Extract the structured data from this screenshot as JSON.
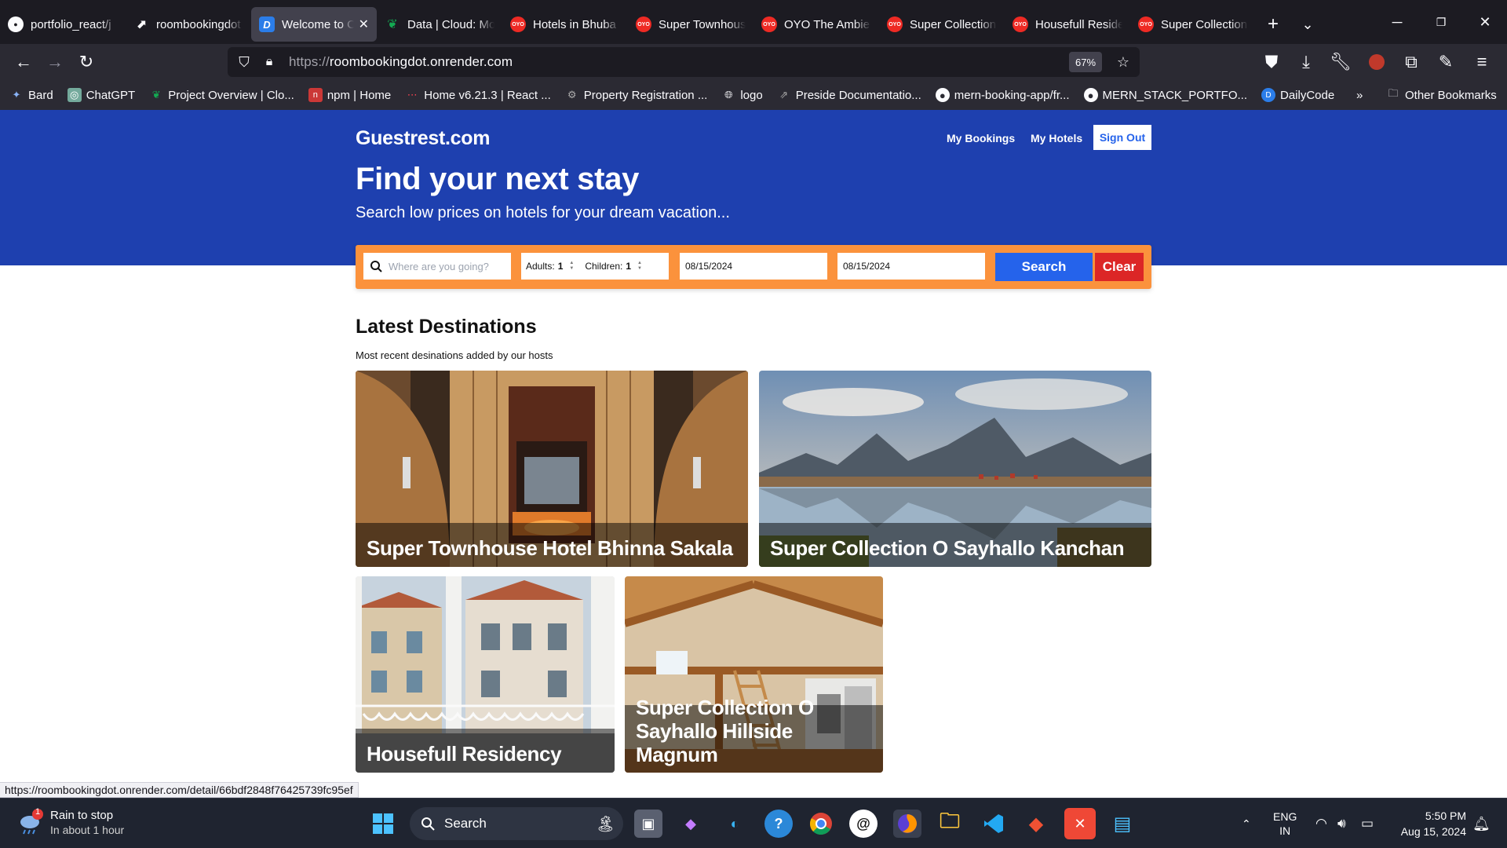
{
  "browser": {
    "tabs": [
      {
        "title": "portfolio_react/j",
        "favicon": "github-icon",
        "active": false
      },
      {
        "title": "roombookingdot",
        "favicon": "render-icon",
        "active": false
      },
      {
        "title": "Welcome to C",
        "favicon": "dailycode-icon",
        "active": true
      },
      {
        "title": "Data | Cloud: Mo",
        "favicon": "mongodb-icon",
        "active": false
      },
      {
        "title": "Hotels in Bhuba",
        "favicon": "oyo-icon",
        "active": false
      },
      {
        "title": "Super Townhous",
        "favicon": "oyo-icon",
        "active": false
      },
      {
        "title": "OYO The Ambie",
        "favicon": "oyo-icon",
        "active": false
      },
      {
        "title": "Super Collection",
        "favicon": "oyo-icon",
        "active": false
      },
      {
        "title": "Housefull Reside",
        "favicon": "oyo-icon",
        "active": false
      },
      {
        "title": "Super Collection",
        "favicon": "oyo-icon",
        "active": false
      }
    ],
    "oyo_label": "OYO",
    "url_proto": "https://",
    "url_host": "roombookingdot.onrender.com",
    "zoom": "67%",
    "bookmarks": [
      {
        "label": "Bard",
        "icon": "bard-icon"
      },
      {
        "label": "ChatGPT",
        "icon": "chatgpt-icon"
      },
      {
        "label": "Project Overview | Clo...",
        "icon": "mongodb-icon"
      },
      {
        "label": "npm | Home",
        "icon": "npm-icon"
      },
      {
        "label": "Home v6.21.3 | React ...",
        "icon": "react-router-icon"
      },
      {
        "label": "Property Registration ...",
        "icon": "gear-icon"
      },
      {
        "label": "logo",
        "icon": "globe-icon"
      },
      {
        "label": "Preside Documentatio...",
        "icon": "preside-icon"
      },
      {
        "label": "mern-booking-app/fr...",
        "icon": "github-icon"
      },
      {
        "label": "MERN_STACK_PORTFO...",
        "icon": "github-icon"
      },
      {
        "label": "DailyCode",
        "icon": "dailycode-icon"
      }
    ],
    "other_bookmarks": "Other Bookmarks",
    "status_url": "https://roombookingdot.onrender.com/detail/66bdf2848f76425739fc95ef"
  },
  "site": {
    "brand": "Guestrest.com",
    "nav": {
      "my_bookings": "My Bookings",
      "my_hotels": "My Hotels",
      "sign_out": "Sign Out"
    },
    "hero": {
      "title": "Find your next stay",
      "subtitle": "Search low prices on hotels for your dream vacation..."
    },
    "search": {
      "destination_placeholder": "Where are you going?",
      "adults_label": "Adults:",
      "adults_value": "1",
      "children_label": "Children:",
      "children_value": "1",
      "check_in": "08/15/2024",
      "check_out": "08/15/2024",
      "search_button": "Search",
      "clear_button": "Clear"
    },
    "latest": {
      "title": "Latest Destinations",
      "subtitle": "Most recent desinations added by our hosts",
      "cards": [
        {
          "name": "Super Townhouse Hotel Bhinna Sakala"
        },
        {
          "name": "Super Collection O Sayhallo Kanchan"
        },
        {
          "name": "Housefull Residency"
        },
        {
          "name": "Super Collection O Sayhallo Hillside Magnum"
        }
      ]
    }
  },
  "taskbar": {
    "weather_title": "Rain to stop",
    "weather_sub": "In about 1 hour",
    "weather_badge": "1",
    "search_label": "Search",
    "lang_line1": "ENG",
    "lang_line2": "IN",
    "time": "5:50 PM",
    "date": "Aug 15, 2024"
  },
  "colors": {
    "hero_blue": "#1e40af",
    "search_orange": "#fb923c",
    "search_button": "#2563eb",
    "clear_button": "#dc2626"
  }
}
